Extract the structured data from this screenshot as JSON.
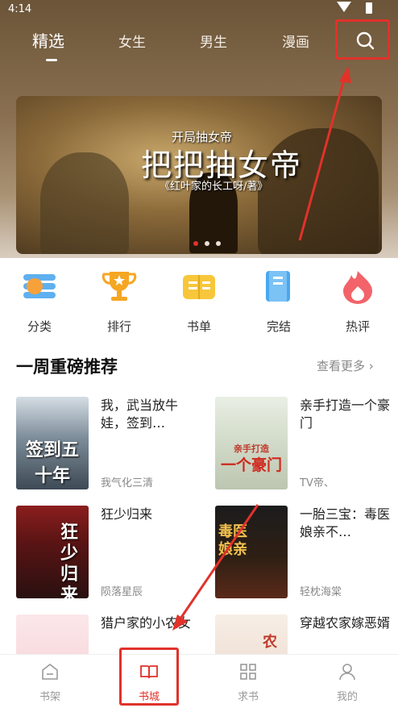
{
  "status_bar": {
    "time": "4:14"
  },
  "tabs": [
    {
      "label": "精选"
    },
    {
      "label": "女生"
    },
    {
      "label": "男生"
    },
    {
      "label": "漫画"
    }
  ],
  "search": {
    "icon": "search-icon"
  },
  "banner": {
    "subtitle": "开局抽女帝",
    "title": "把把抽女帝",
    "author": "《红叶家的长工呀/著》"
  },
  "menu": [
    {
      "label": "分类",
      "icon": "category-icon"
    },
    {
      "label": "排行",
      "icon": "trophy-icon"
    },
    {
      "label": "书单",
      "icon": "booklist-icon"
    },
    {
      "label": "完结",
      "icon": "finished-book-icon"
    },
    {
      "label": "热评",
      "icon": "flame-icon"
    }
  ],
  "section": {
    "title": "一周重磅推荐",
    "more": "查看更多 ›"
  },
  "books": [
    {
      "title": "我，武当放牛娃，签到…",
      "author": "我气化三清",
      "cover_text": "签到五十年"
    },
    {
      "title": "亲手打造一个豪门",
      "author": "TV帝、",
      "cover_text": "一个豪门",
      "cover_subtitle": "亲手打造"
    },
    {
      "title": "狂少归来",
      "author": "陨落星辰",
      "cover_text": "狂少归来"
    },
    {
      "title": "一胎三宝：毒医娘亲不…",
      "author": "轻枕海棠",
      "cover_text": "毒医娘亲"
    },
    {
      "title": "猎户家的小农女",
      "author": "",
      "cover_text": ""
    },
    {
      "title": "穿越农家嫁恶婿",
      "author": "",
      "cover_text": "农"
    }
  ],
  "bottom_nav": [
    {
      "label": "书架",
      "icon": "bookshelf-icon"
    },
    {
      "label": "书城",
      "icon": "open-book-icon",
      "active": true
    },
    {
      "label": "求书",
      "icon": "grid-icon"
    },
    {
      "label": "我的",
      "icon": "user-icon"
    }
  ],
  "colors": {
    "accent": "#e1322a",
    "header_bg": "#6b5438"
  }
}
